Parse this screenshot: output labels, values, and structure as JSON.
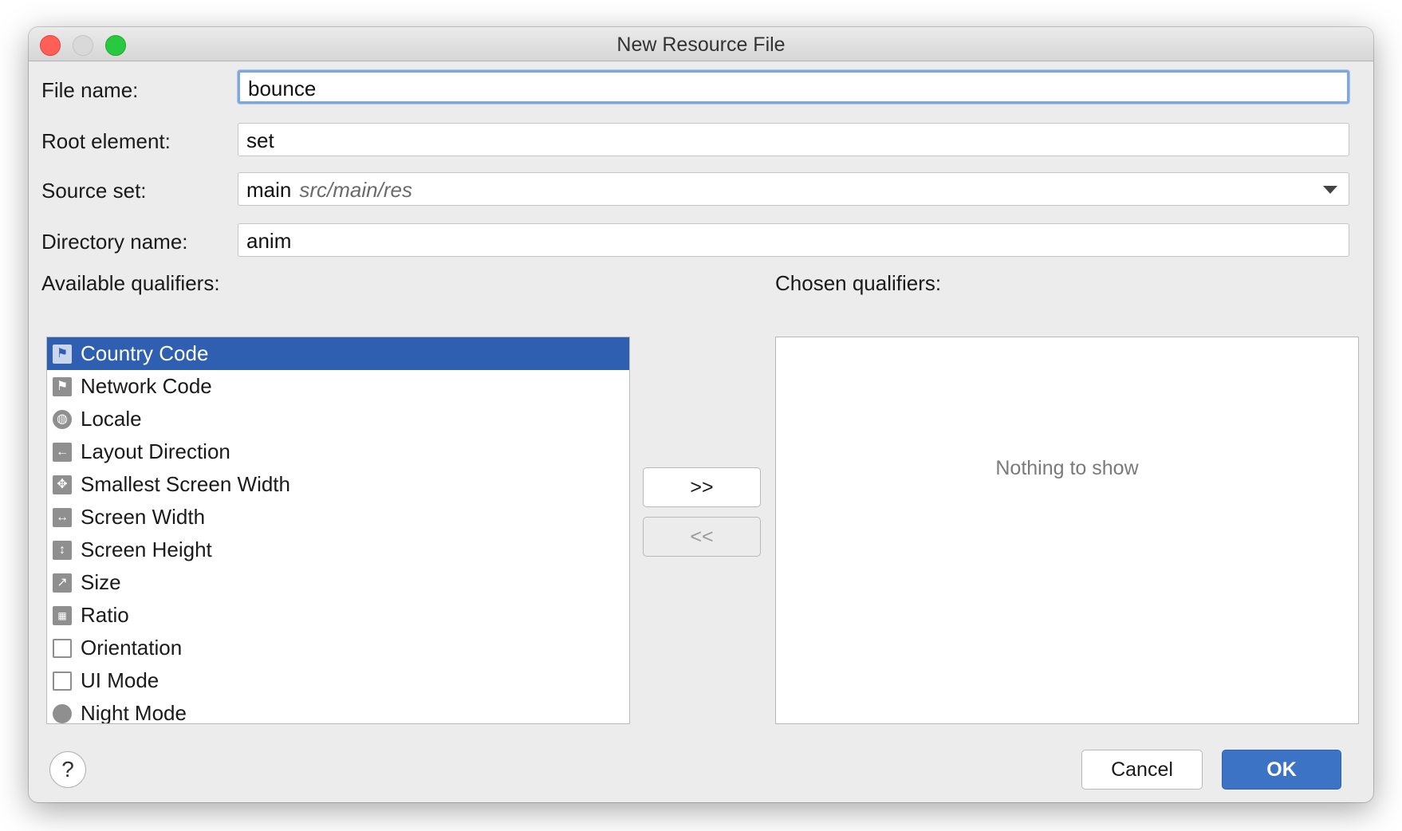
{
  "window": {
    "title": "New Resource File"
  },
  "form": {
    "file_name": {
      "label": "File name:",
      "value": "bounce"
    },
    "root_element": {
      "label": "Root element:",
      "value": "set"
    },
    "source_set": {
      "label": "Source set:",
      "value": "main",
      "sub": "src/main/res"
    },
    "directory_name": {
      "label": "Directory name:",
      "value": "anim"
    }
  },
  "qualifiers": {
    "available_label": "Available qualifiers:",
    "chosen_label": "Chosen qualifiers:",
    "empty_text": "Nothing to show",
    "items": [
      {
        "label": "Country Code",
        "icon": "country-code-icon",
        "selected": true
      },
      {
        "label": "Network Code",
        "icon": "network-code-icon"
      },
      {
        "label": "Locale",
        "icon": "globe-icon"
      },
      {
        "label": "Layout Direction",
        "icon": "arrow-left-icon"
      },
      {
        "label": "Smallest Screen Width",
        "icon": "expand-arrows-icon"
      },
      {
        "label": "Screen Width",
        "icon": "horizontal-arrows-icon"
      },
      {
        "label": "Screen Height",
        "icon": "vertical-arrows-icon"
      },
      {
        "label": "Size",
        "icon": "diagonal-arrow-icon"
      },
      {
        "label": "Ratio",
        "icon": "ratio-icon"
      },
      {
        "label": "Orientation",
        "icon": "orientation-icon"
      },
      {
        "label": "UI Mode",
        "icon": "ui-mode-icon"
      },
      {
        "label": "Night Mode",
        "icon": "night-mode-icon"
      }
    ],
    "add_button": ">>",
    "remove_button": "<<"
  },
  "buttons": {
    "cancel": "Cancel",
    "ok": "OK",
    "help": "?"
  }
}
